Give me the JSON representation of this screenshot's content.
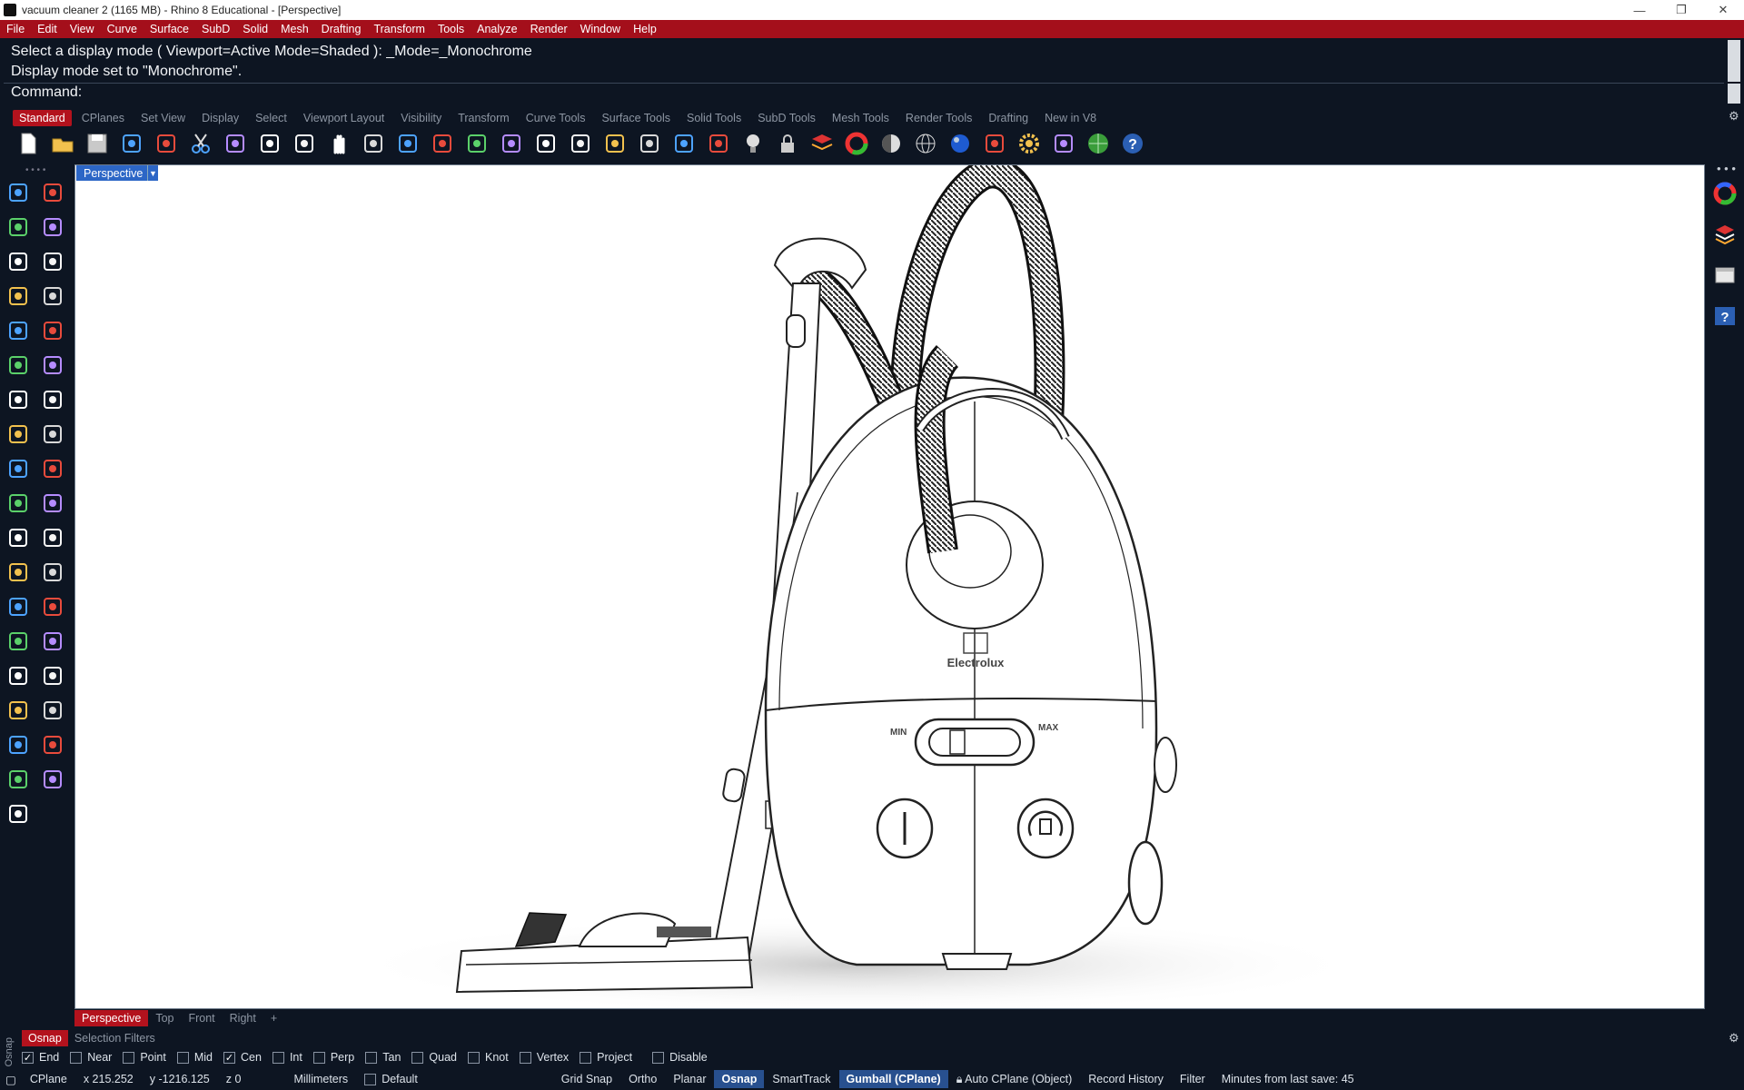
{
  "window": {
    "title": "vacuum cleaner 2 (1165 MB) - Rhino 8 Educational - [Perspective]",
    "minimize": "—",
    "restore": "❐",
    "close": "✕"
  },
  "menu": [
    "File",
    "Edit",
    "View",
    "Curve",
    "Surface",
    "SubD",
    "Solid",
    "Mesh",
    "Drafting",
    "Transform",
    "Tools",
    "Analyze",
    "Render",
    "Window",
    "Help"
  ],
  "command": {
    "history": [
      "Select a display mode ( Viewport=Active  Mode=Shaded ): _Mode=_Monochrome",
      "Display mode set to \"Monochrome\"."
    ],
    "prompt": "Command:"
  },
  "toolbar_tabs": [
    "Standard",
    "CPlanes",
    "Set View",
    "Display",
    "Select",
    "Viewport Layout",
    "Visibility",
    "Transform",
    "Curve Tools",
    "Surface Tools",
    "Solid Tools",
    "SubD Tools",
    "Mesh Tools",
    "Render Tools",
    "Drafting",
    "New in V8"
  ],
  "active_toolbar_tab": "Standard",
  "toolbar_icons": [
    "new-file",
    "open-file",
    "save",
    "print",
    "import",
    "cut",
    "copy",
    "paste",
    "undo",
    "pan",
    "rotate-view",
    "zoom",
    "zoom-window",
    "zoom-extents",
    "zoom-selected",
    "undo-view",
    "four-viewports",
    "car-named-views",
    "cplane-grid",
    "osnap-toggle",
    "object-properties",
    "light-bulb",
    "lock",
    "layers",
    "color-wheel",
    "shaded-sphere",
    "wireframe-sphere",
    "render-sphere",
    "material",
    "settings-gear",
    "dimension",
    "globe",
    "help"
  ],
  "left_tools": [
    "select-arrow",
    "point",
    "polyline",
    "curve",
    "circle",
    "ellipse",
    "arc",
    "rectangle",
    "polygon",
    "fillet-curve",
    "surface-srf",
    "revolve",
    "box-solid",
    "sphere-solid",
    "cylinder",
    "mesh",
    "explode",
    "blast",
    "transform-move",
    "transform-scale",
    "boolean-union",
    "boolean-split",
    "offset",
    "fillet",
    "text",
    "scale",
    "array",
    "drape",
    "solid-edit",
    "history-arrows",
    "grid-array",
    "dimension",
    "analyze",
    "gumball",
    "check",
    "shade",
    "drafting-pen"
  ],
  "viewport": {
    "label": "Perspective",
    "logo_text": "Electrolux",
    "min_label": "MIN",
    "max_label": "MAX"
  },
  "right_tools": [
    "color-wheel",
    "layers-panel",
    "properties-panel",
    "help-panel"
  ],
  "viewport_tabs": [
    "Perspective",
    "Top",
    "Front",
    "Right",
    "+"
  ],
  "active_viewport_tab": "Perspective",
  "snap_tabs": [
    "Osnap",
    "Selection Filters"
  ],
  "active_snap_tab": "Osnap",
  "side_label": "Osnap",
  "osnaps": [
    {
      "label": "End",
      "checked": true
    },
    {
      "label": "Near",
      "checked": false
    },
    {
      "label": "Point",
      "checked": false
    },
    {
      "label": "Mid",
      "checked": false
    },
    {
      "label": "Cen",
      "checked": true
    },
    {
      "label": "Int",
      "checked": false
    },
    {
      "label": "Perp",
      "checked": false
    },
    {
      "label": "Tan",
      "checked": false
    },
    {
      "label": "Quad",
      "checked": false
    },
    {
      "label": "Knot",
      "checked": false
    },
    {
      "label": "Vertex",
      "checked": false
    },
    {
      "label": "Project",
      "checked": false
    },
    {
      "label": "Disable",
      "checked": false
    }
  ],
  "status": {
    "cplane": "CPlane",
    "x": "x 215.252",
    "y": "y -1216.125",
    "z": "z 0",
    "units": "Millimeters",
    "layer": "Default",
    "grid_snap": "Grid Snap",
    "ortho": "Ortho",
    "planar": "Planar",
    "osnap": "Osnap",
    "smarttrack": "SmartTrack",
    "gumball": "Gumball (CPlane)",
    "auto_cplane": "Auto CPlane (Object)",
    "record_history": "Record History",
    "filter": "Filter",
    "last_save": "Minutes from last save: 45"
  },
  "colors": {
    "menu_red": "#a40f1b",
    "tab_red": "#b3121d",
    "viewport_blue": "#2c66c6",
    "status_highlight": "#28508f",
    "background": "#0d1522"
  }
}
